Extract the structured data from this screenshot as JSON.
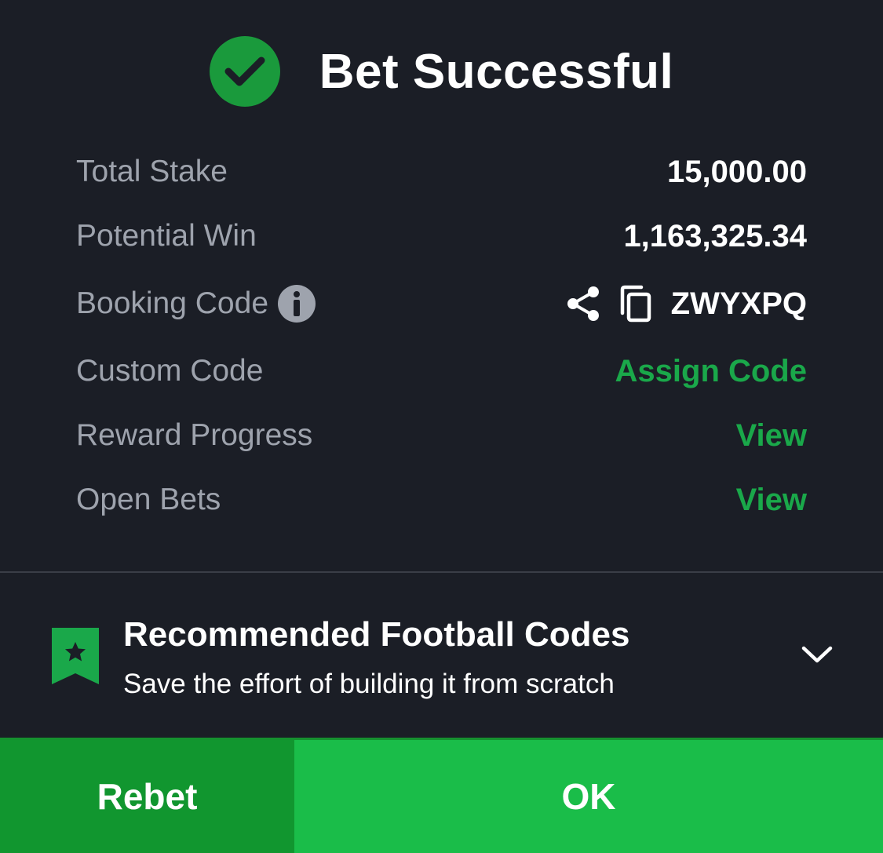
{
  "header": {
    "title": "Bet Successful"
  },
  "summary": {
    "total_stake": {
      "label": "Total Stake",
      "value": "15,000.00"
    },
    "potential_win": {
      "label": "Potential Win",
      "value": "1,163,325.34"
    },
    "booking_code": {
      "label": "Booking Code",
      "value": "ZWYXPQ"
    },
    "custom_code": {
      "label": "Custom Code",
      "action": "Assign Code"
    },
    "reward_progress": {
      "label": "Reward Progress",
      "action": "View"
    },
    "open_bets": {
      "label": "Open Bets",
      "action": "View"
    }
  },
  "recommended": {
    "title": "Recommended Football Codes",
    "subtitle": "Save the effort of building it from scratch"
  },
  "footer": {
    "rebet_label": "Rebet",
    "ok_label": "OK"
  },
  "colors": {
    "background": "#1b1e26",
    "accent_green": "#1aa84a",
    "ok_button": "#1abd49",
    "rebet_button": "#11962f",
    "label_gray": "#9ea3ad"
  }
}
